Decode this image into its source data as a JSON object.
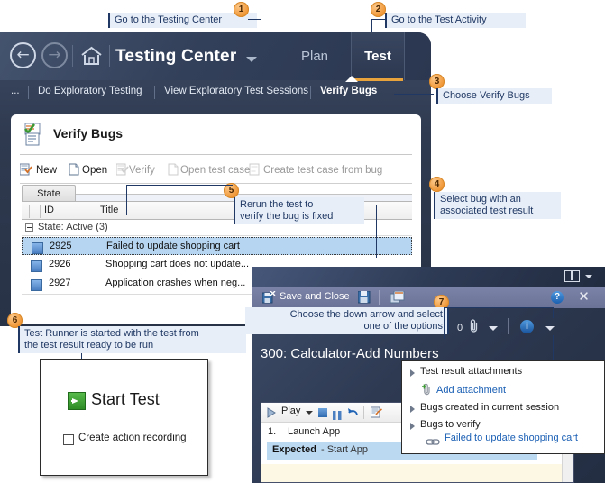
{
  "callouts": [
    {
      "num": "1",
      "text": "Go to the Testing Center"
    },
    {
      "num": "2",
      "text": "Go to the Test Activity"
    },
    {
      "num": "3",
      "text": "Choose Verify Bugs"
    },
    {
      "num": "4",
      "text": "Select bug with an\nassociated test result"
    },
    {
      "num": "5",
      "text": "Rerun the test to\nverify the bug is fixed"
    },
    {
      "num": "6",
      "text": "Test Runner is started with the test from\nthe test result ready to be run"
    },
    {
      "num": "7",
      "text": "Choose the down arrow and select\none of the options"
    }
  ],
  "testing_center": {
    "title": "Testing Center",
    "back_arrow": "←",
    "forward_arrow": "→",
    "tabs": [
      {
        "label": "Plan",
        "active": false
      },
      {
        "label": "Test",
        "active": true
      }
    ],
    "subnav": {
      "ellipsis": "...",
      "items": [
        {
          "label": "Do Exploratory Testing",
          "active": false
        },
        {
          "label": "View Exploratory Test Sessions",
          "active": false
        },
        {
          "label": "Verify Bugs",
          "active": true
        }
      ]
    }
  },
  "verify_bugs": {
    "heading": "Verify Bugs",
    "toolbar": [
      {
        "label": "New",
        "disabled": false
      },
      {
        "label": "Open",
        "disabled": false
      },
      {
        "label": "Verify",
        "disabled": true
      },
      {
        "label": "Open test case",
        "disabled": true
      },
      {
        "label": "Create test case from bug",
        "disabled": true
      }
    ],
    "state_tab": "State",
    "columns": [
      "ID",
      "Title"
    ],
    "group_row": "State: Active (3)",
    "rows": [
      {
        "id": "2925",
        "title": "Failed to update shopping cart",
        "selected": true
      },
      {
        "id": "2926",
        "title": "Shopping cart does not update...",
        "selected": false
      },
      {
        "id": "2927",
        "title": "Application crashes when neg...",
        "selected": false
      }
    ]
  },
  "start_test_box": {
    "button_label": "Start Test",
    "checkbox_label": "Create action recording"
  },
  "test_runner": {
    "toolbar": {
      "save_and_close": "Save and Close",
      "help_glyph": "?",
      "close_glyph": "✕"
    },
    "attachment_count": "0",
    "test_title": "300: Calculator-Add Numbers",
    "info_glyph": "i",
    "steps": {
      "play_label": "Play",
      "step_number": "1.",
      "step_name": "Launch App",
      "expected_label": "Expected",
      "expected_value": "- Start App"
    }
  },
  "attachments_dropdown": {
    "groups": [
      {
        "label": "Test result attachments"
      },
      {
        "label": "Bugs created in current session"
      },
      {
        "label": "Bugs to verify"
      }
    ],
    "add_attachment": "Add attachment",
    "bug_link": "Failed to update shopping cart"
  },
  "colors": {
    "accent_orange": "#e8a33d",
    "callout_bg": "#e8eef7",
    "callout_text": "#1f3864",
    "selection_blue": "#b5d5f0",
    "link_blue": "#1a5fb4"
  }
}
